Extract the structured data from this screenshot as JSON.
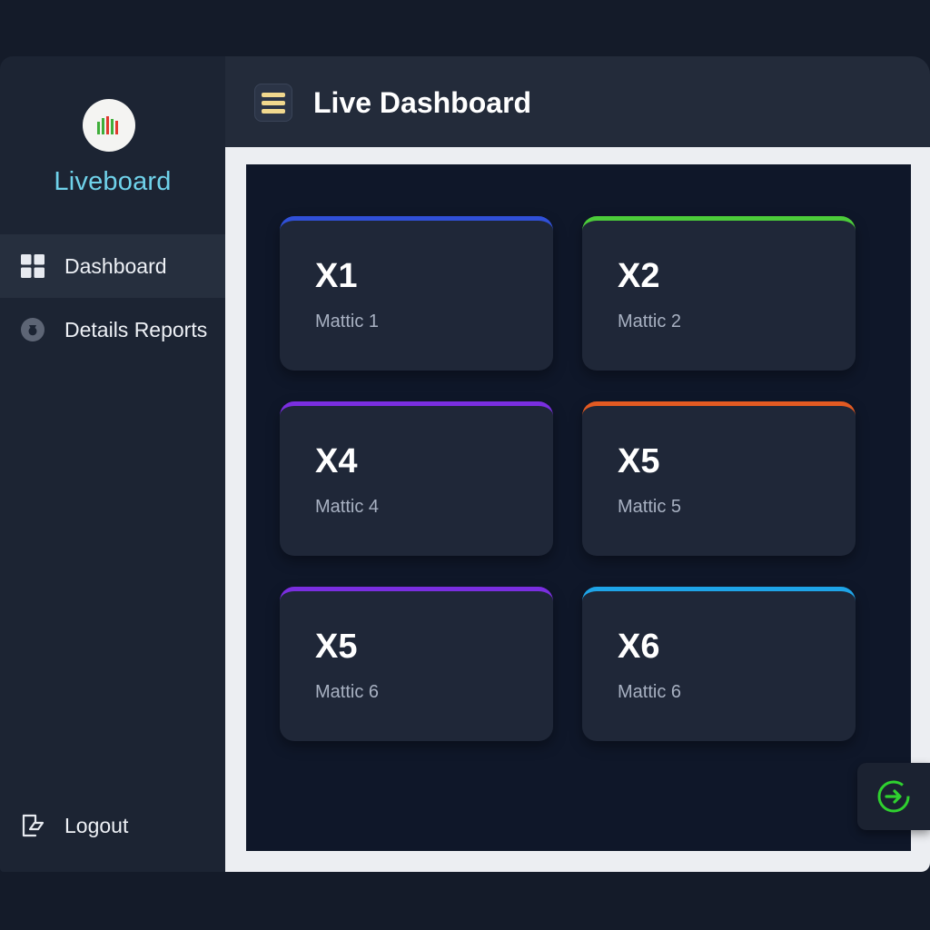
{
  "sidebar": {
    "brand": "Liveboard",
    "items": [
      {
        "label": "Dashboard",
        "icon": "grid-icon",
        "active": true
      },
      {
        "label": "Details Reports",
        "icon": "badge-icon",
        "active": false
      }
    ],
    "logout": {
      "label": "Logout",
      "icon": "logout-icon"
    }
  },
  "header": {
    "title": "Live Dashboard",
    "menu_icon": "hamburger-menu-icon"
  },
  "cards": [
    {
      "code": "X1",
      "label": "Mattic 1",
      "accent": "#3050d8"
    },
    {
      "code": "X2",
      "label": "Mattic 2",
      "accent": "#4ccc3a"
    },
    {
      "code": "X4",
      "label": "Mattic 4",
      "accent": "#7a2ee0"
    },
    {
      "code": "X5",
      "label": "Mattic 5",
      "accent": "#e35a22"
    },
    {
      "code": "X5",
      "label": "Mattic 6",
      "accent": "#7a2ee0"
    },
    {
      "code": "X6",
      "label": "Mattic 6",
      "accent": "#1ea4e8"
    }
  ],
  "fab": {
    "icon": "arrow-circle-right-icon",
    "color": "#2fd12f"
  },
  "colors": {
    "brand": "#6fd2ea",
    "menu_icon": "#f1d88e"
  }
}
